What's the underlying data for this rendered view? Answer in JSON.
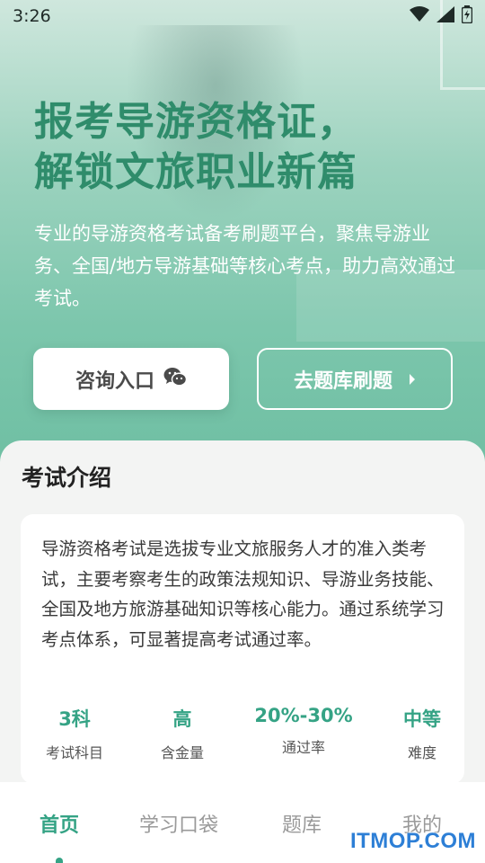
{
  "status_bar": {
    "time": "3:26",
    "icons": [
      "wifi-icon",
      "cellular-signal-icon",
      "battery-icon"
    ]
  },
  "hero": {
    "headline_line1": "报考导游资格证，",
    "headline_line2": "解锁文旅职业新篇",
    "subtitle": "专业的导游资格考试备考刷题平台，聚焦导游业务、全国/地方导游基础等核心考点，助力高效通过考试。",
    "consult_button": {
      "label": "咨询入口",
      "icon": "wechat-icon"
    },
    "bank_button": {
      "label": "去题库刷题",
      "icon": "chevron-right-icon"
    }
  },
  "intro": {
    "title": "考试介绍",
    "description": "导游资格考试是选拔专业文旅服务人才的准入类考试，主要考察考生的政策法规知识、导游业务技能、全国及地方旅游基础知识等核心能力。通过系统学习考点体系，可显著提高考试通过率。",
    "stats": [
      {
        "value": "3科",
        "label": "考试科目"
      },
      {
        "value": "高",
        "label": "含金量"
      },
      {
        "value": "20%-30%",
        "label": "通过率"
      },
      {
        "value": "中等",
        "label": "难度"
      }
    ]
  },
  "tabbar": {
    "tabs": [
      {
        "label": "首页",
        "active": true
      },
      {
        "label": "学习口袋",
        "active": false
      },
      {
        "label": "题库",
        "active": false
      },
      {
        "label": "我的",
        "active": false
      }
    ]
  },
  "watermark": "ITMOP.COM",
  "colors": {
    "accent": "#35a385",
    "headline": "#2f8c6b",
    "hero_bg": "#7cc6ac"
  }
}
